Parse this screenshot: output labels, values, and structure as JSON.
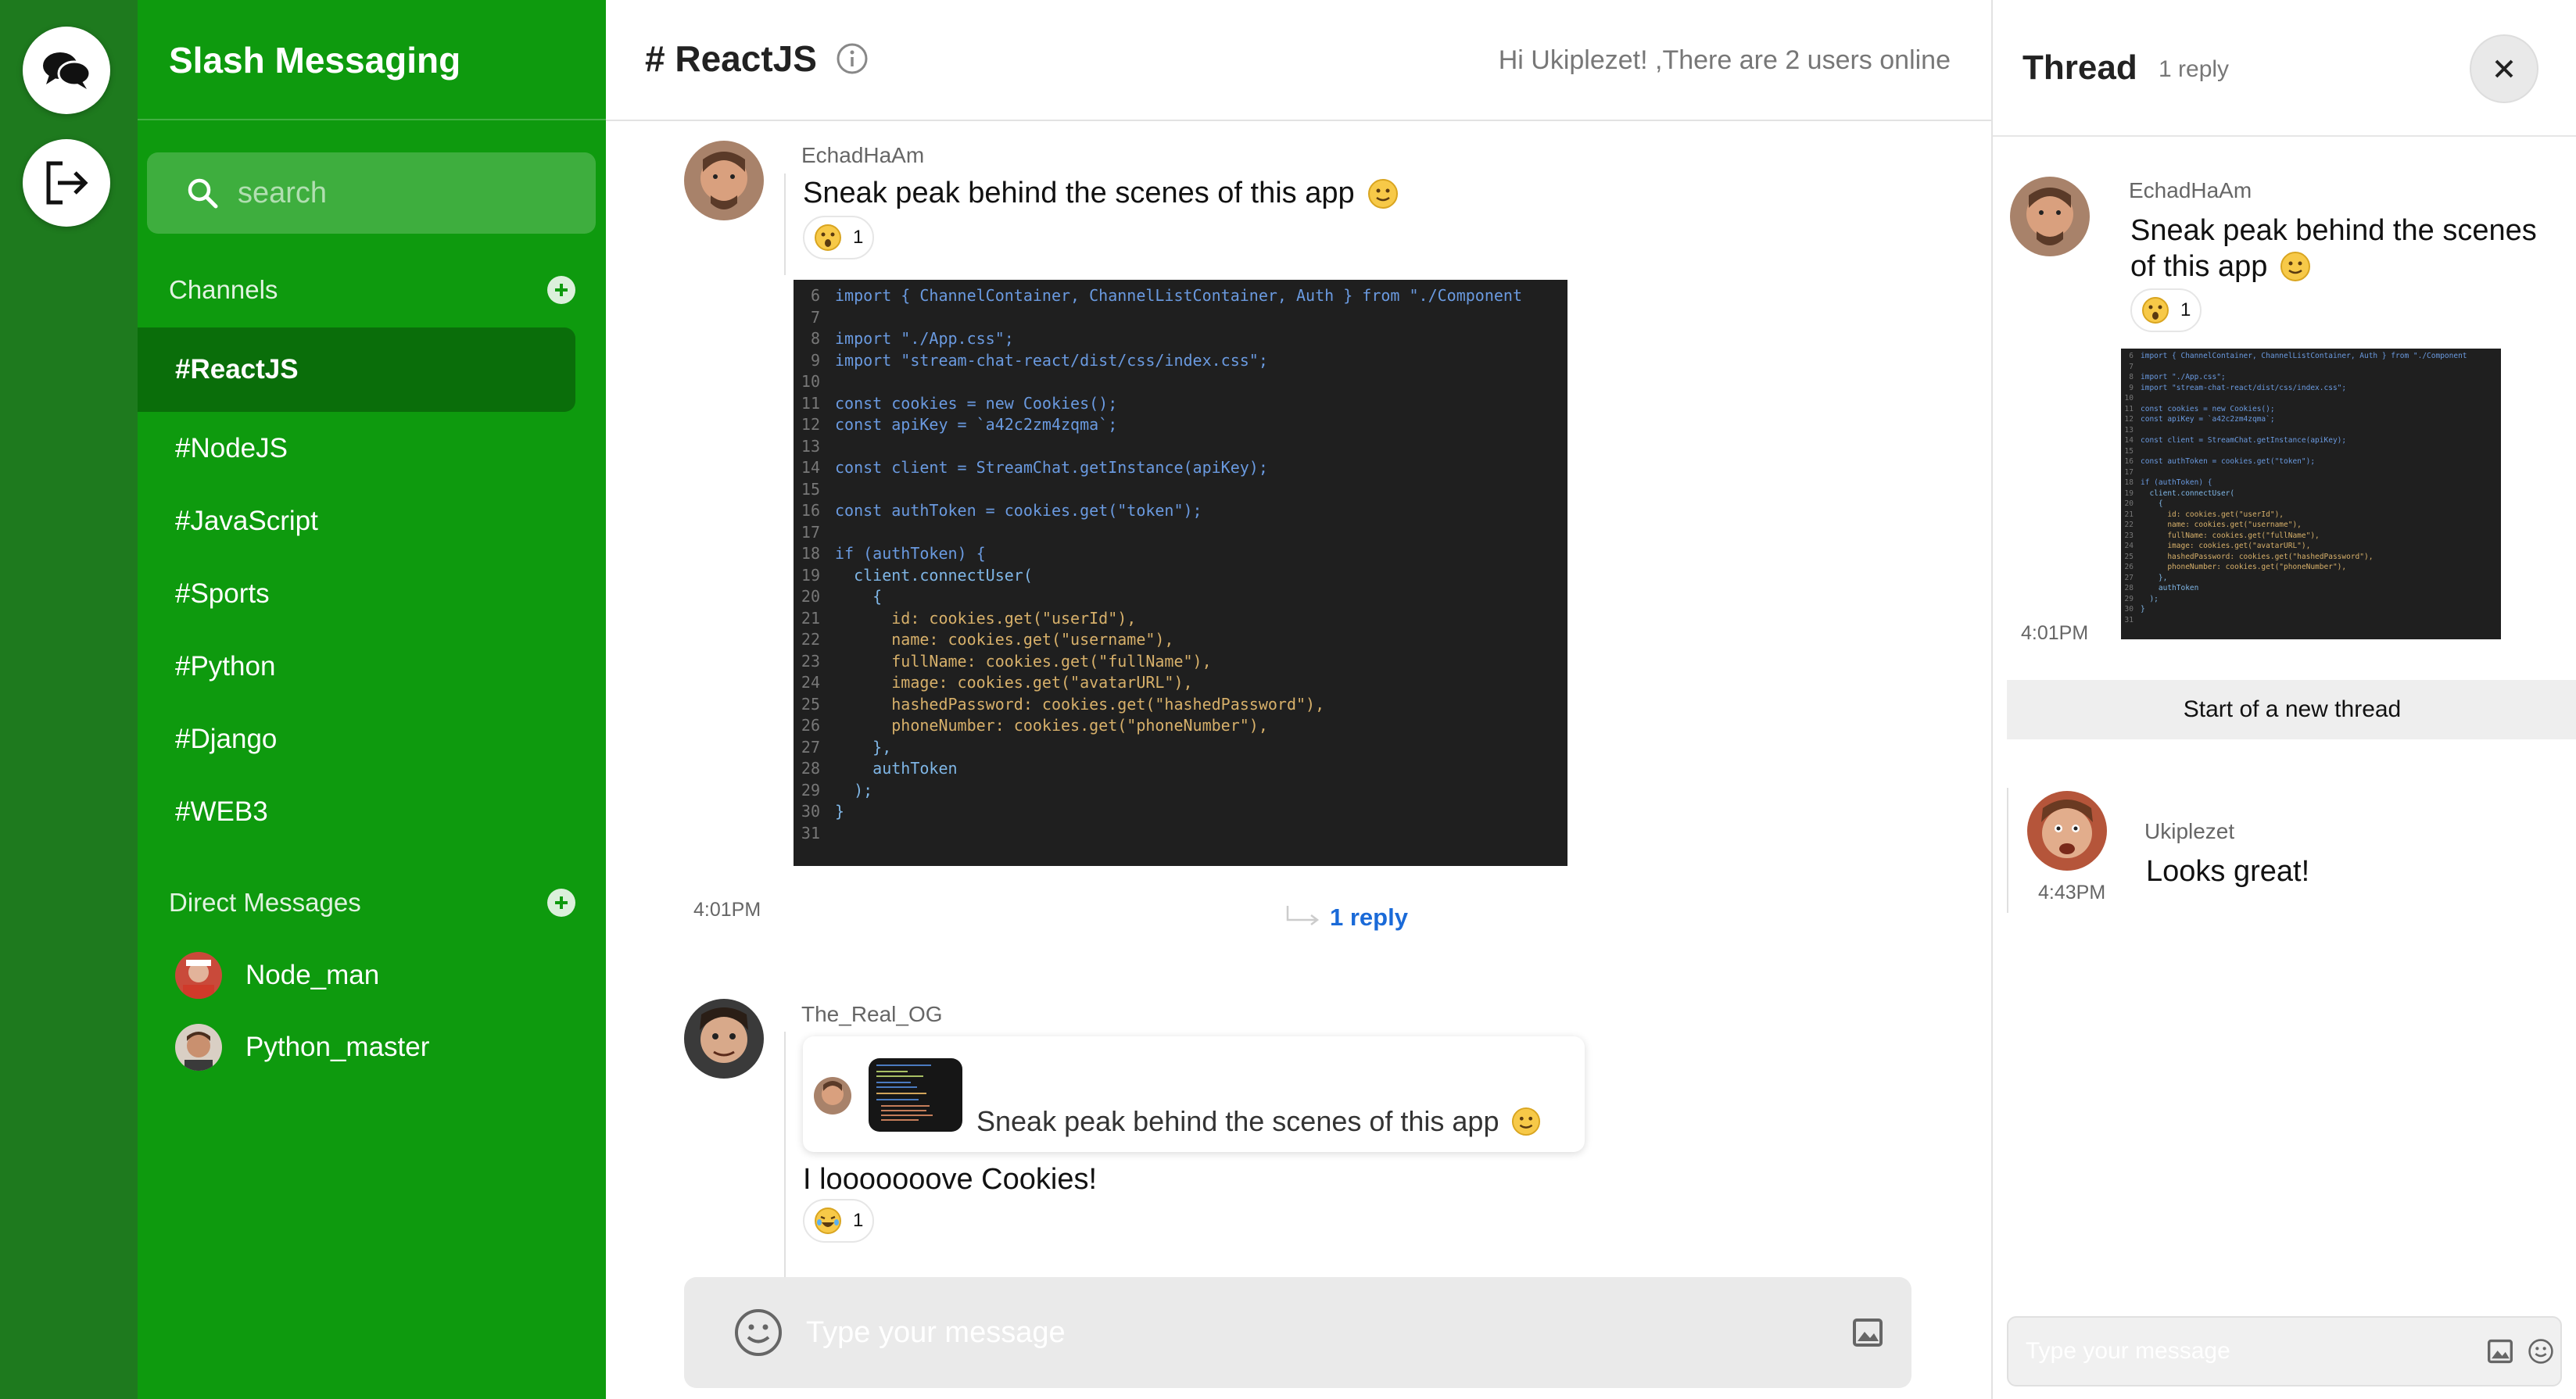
{
  "app": {
    "title": "Slash Messaging"
  },
  "rail": {
    "chat_icon": "chat-bubbles-icon",
    "logout_icon": "logout-icon"
  },
  "search": {
    "placeholder": "search"
  },
  "sidebar": {
    "channels_label": "Channels",
    "channels": [
      "#ReactJS",
      "#NodeJS",
      "#JavaScript",
      "#Sports",
      "#Python",
      "#Django",
      "#WEB3"
    ],
    "active_channel": "#ReactJS",
    "dm_label": "Direct Messages",
    "dms": [
      "Node_man",
      "Python_master"
    ]
  },
  "header": {
    "channel_title": "# ReactJS",
    "online_text": "Hi Ukiplezet! ,There are 2 users online"
  },
  "messages": [
    {
      "user": "EchadHaAm",
      "text": "Sneak peak behind the scenes of this app",
      "reaction_count": "1",
      "time": "4:01PM",
      "reply_label": "1 reply"
    },
    {
      "user": "The_Real_OG",
      "quote_text": "Sneak peak behind the scenes of this app",
      "text": "I looooooove Cookies!",
      "reaction_count": "1"
    }
  ],
  "code": {
    "lines": [
      {
        "n": "6",
        "t": "import { ChannelContainer, ChannelListContainer, Auth } from \"./Component"
      },
      {
        "n": "7",
        "t": ""
      },
      {
        "n": "8",
        "t": "import \"./App.css\";"
      },
      {
        "n": "9",
        "t": "import \"stream-chat-react/dist/css/index.css\";"
      },
      {
        "n": "10",
        "t": ""
      },
      {
        "n": "11",
        "t": "const cookies = new Cookies();"
      },
      {
        "n": "12",
        "t": "const apiKey = `a42c2zm4zqma`;"
      },
      {
        "n": "13",
        "t": ""
      },
      {
        "n": "14",
        "t": "const client = StreamChat.getInstance(apiKey);"
      },
      {
        "n": "15",
        "t": ""
      },
      {
        "n": "16",
        "t": "const authToken = cookies.get(\"token\");"
      },
      {
        "n": "17",
        "t": ""
      },
      {
        "n": "18",
        "t": "if (authToken) {"
      },
      {
        "n": "19",
        "t": "  client.connectUser("
      },
      {
        "n": "20",
        "t": "    {"
      },
      {
        "n": "21",
        "t": "      id: cookies.get(\"userId\"),"
      },
      {
        "n": "22",
        "t": "      name: cookies.get(\"username\"),"
      },
      {
        "n": "23",
        "t": "      fullName: cookies.get(\"fullName\"),"
      },
      {
        "n": "24",
        "t": "      image: cookies.get(\"avatarURL\"),"
      },
      {
        "n": "25",
        "t": "      hashedPassword: cookies.get(\"hashedPassword\"),"
      },
      {
        "n": "26",
        "t": "      phoneNumber: cookies.get(\"phoneNumber\"),"
      },
      {
        "n": "27",
        "t": "    },"
      },
      {
        "n": "28",
        "t": "    authToken"
      },
      {
        "n": "29",
        "t": "  );"
      },
      {
        "n": "30",
        "t": "}"
      },
      {
        "n": "31",
        "t": ""
      }
    ]
  },
  "composer": {
    "placeholder": "Type your message"
  },
  "thread": {
    "title": "Thread",
    "count": "1 reply",
    "parent": {
      "user": "EchadHaAm",
      "text_line1": "Sneak peak behind the scenes",
      "text_line2": "of this app",
      "reaction_count": "1",
      "time": "4:01PM"
    },
    "start_label": "Start of a new thread",
    "reply": {
      "user": "Ukiplezet",
      "text": "Looks great!",
      "time": "4:43PM"
    },
    "composer_placeholder": "Type your message"
  },
  "colors": {
    "rail": "#1e7a1e",
    "sidebar": "#0e9a0e",
    "active_channel": "#0a6e0a",
    "link": "#1a6ad8",
    "code_bg": "#1f1f1f"
  }
}
